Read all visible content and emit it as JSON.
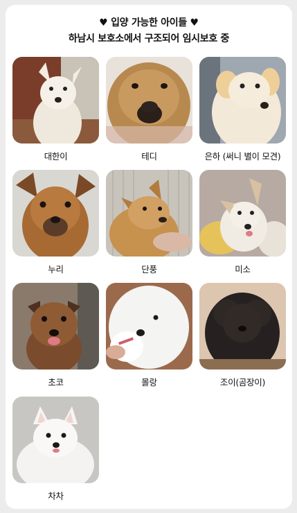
{
  "header": {
    "title": "♥ 입양 가능한 아이들 ♥",
    "subtitle": "하남시 보호소에서 구조되어 임시보호 중"
  },
  "dogs": [
    {
      "name": "대한이",
      "icon": "white-dog-photo"
    },
    {
      "name": "테디",
      "icon": "tan-dog-photo"
    },
    {
      "name": "은하 (써니 별이 모견)",
      "icon": "cream-dog-photo"
    },
    {
      "name": "누리",
      "icon": "brown-dog-photo"
    },
    {
      "name": "단풍",
      "icon": "fawn-dog-photo"
    },
    {
      "name": "미소",
      "icon": "cream-white-dog-photo"
    },
    {
      "name": "초코",
      "icon": "brown-dog-photo"
    },
    {
      "name": "몰랑",
      "icon": "white-spitz-photo"
    },
    {
      "name": "조이(곰장이)",
      "icon": "black-poodle-photo"
    },
    {
      "name": "차차",
      "icon": "white-spitz-photo"
    }
  ]
}
